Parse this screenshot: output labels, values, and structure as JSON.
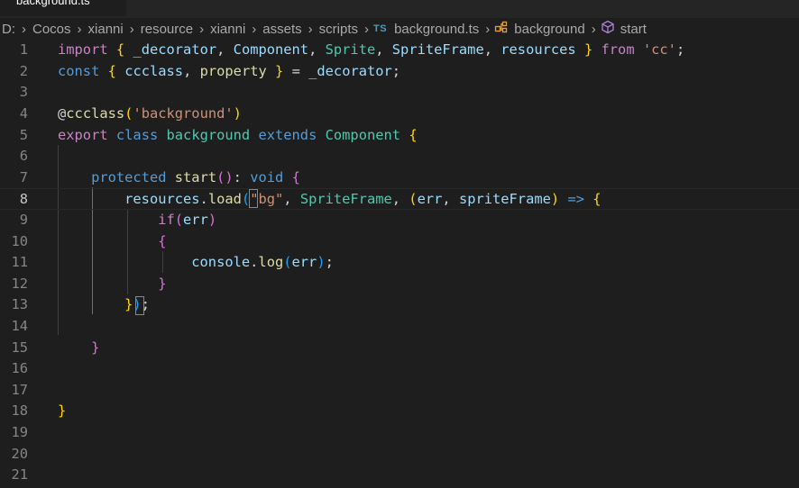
{
  "editor_tab": {
    "title": "background.ts"
  },
  "breadcrumb": {
    "items": [
      "D:",
      "Cocos",
      "xianni",
      "resource",
      "xianni",
      "assets",
      "scripts"
    ],
    "file_badge": "TS",
    "file": "background.ts",
    "class_symbol": "background",
    "method_symbol": "start"
  },
  "line_numbers": [
    "1",
    "2",
    "3",
    "4",
    "5",
    "6",
    "7",
    "8",
    "9",
    "10",
    "11",
    "12",
    "13",
    "14",
    "15",
    "16",
    "17",
    "18",
    "19",
    "20",
    "21"
  ],
  "current_line": 8,
  "code_lines": [
    [
      [
        "k",
        "import"
      ],
      [
        "p",
        " "
      ],
      [
        "b1",
        "{"
      ],
      [
        "p",
        " "
      ],
      [
        "v",
        "_decorator"
      ],
      [
        "p",
        ", "
      ],
      [
        "v",
        "Component"
      ],
      [
        "p",
        ", "
      ],
      [
        "t",
        "Sprite"
      ],
      [
        "p",
        ", "
      ],
      [
        "v",
        "SpriteFrame"
      ],
      [
        "p",
        ", "
      ],
      [
        "v",
        "resources"
      ],
      [
        "p",
        " "
      ],
      [
        "b1",
        "}"
      ],
      [
        "p",
        " "
      ],
      [
        "k",
        "from"
      ],
      [
        "p",
        " "
      ],
      [
        "s",
        "'cc'"
      ],
      [
        "p",
        ";"
      ]
    ],
    [
      [
        "kb",
        "const"
      ],
      [
        "p",
        " "
      ],
      [
        "b1",
        "{"
      ],
      [
        "p",
        " "
      ],
      [
        "v",
        "ccclass"
      ],
      [
        "p",
        ", "
      ],
      [
        "f",
        "property"
      ],
      [
        "p",
        " "
      ],
      [
        "b1",
        "}"
      ],
      [
        "p",
        " = "
      ],
      [
        "v",
        "_decorator"
      ],
      [
        "p",
        ";"
      ]
    ],
    [],
    [
      [
        "p",
        "@"
      ],
      [
        "f",
        "ccclass"
      ],
      [
        "b1",
        "("
      ],
      [
        "s",
        "'background'"
      ],
      [
        "b1",
        ")"
      ]
    ],
    [
      [
        "k",
        "export"
      ],
      [
        "p",
        " "
      ],
      [
        "kb",
        "class"
      ],
      [
        "p",
        " "
      ],
      [
        "t",
        "background"
      ],
      [
        "p",
        " "
      ],
      [
        "kb",
        "extends"
      ],
      [
        "p",
        " "
      ],
      [
        "t",
        "Component"
      ],
      [
        "p",
        " "
      ],
      [
        "b1",
        "{"
      ]
    ],
    [],
    [
      [
        "p",
        "    "
      ],
      [
        "kb",
        "protected"
      ],
      [
        "p",
        " "
      ],
      [
        "f",
        "start"
      ],
      [
        "b2",
        "("
      ],
      [
        "b2",
        ")"
      ],
      [
        "p",
        ": "
      ],
      [
        "kb",
        "void"
      ],
      [
        "p",
        " "
      ],
      [
        "b2",
        "{"
      ]
    ],
    [
      [
        "p",
        "        "
      ],
      [
        "v",
        "resources"
      ],
      [
        "p",
        "."
      ],
      [
        "f",
        "load"
      ],
      [
        "b3",
        "("
      ],
      [
        "s",
        "\"bg\""
      ],
      [
        "p",
        ", "
      ],
      [
        "t",
        "SpriteFrame"
      ],
      [
        "p",
        ", "
      ],
      [
        "b1",
        "("
      ],
      [
        "v",
        "err"
      ],
      [
        "p",
        ", "
      ],
      [
        "v",
        "spriteFrame"
      ],
      [
        "b1",
        ")"
      ],
      [
        "p",
        " "
      ],
      [
        "kb",
        "=>"
      ],
      [
        "p",
        " "
      ],
      [
        "b1",
        "{"
      ]
    ],
    [
      [
        "p",
        "            "
      ],
      [
        "k",
        "if"
      ],
      [
        "b2",
        "("
      ],
      [
        "v",
        "err"
      ],
      [
        "b2",
        ")"
      ]
    ],
    [
      [
        "p",
        "            "
      ],
      [
        "b2",
        "{"
      ]
    ],
    [
      [
        "p",
        "                "
      ],
      [
        "v",
        "console"
      ],
      [
        "p",
        "."
      ],
      [
        "f",
        "log"
      ],
      [
        "b3",
        "("
      ],
      [
        "v",
        "err"
      ],
      [
        "b3",
        ")"
      ],
      [
        "p",
        ";"
      ]
    ],
    [
      [
        "p",
        "            "
      ],
      [
        "b2",
        "}"
      ]
    ],
    [
      [
        "p",
        "        "
      ],
      [
        "b1",
        "}"
      ],
      [
        "b3",
        ")"
      ],
      [
        "p",
        ";"
      ]
    ],
    [],
    [
      [
        "p",
        "    "
      ],
      [
        "b2",
        "}"
      ]
    ],
    [],
    [],
    [
      [
        "b1",
        "}"
      ]
    ],
    [],
    [],
    []
  ]
}
